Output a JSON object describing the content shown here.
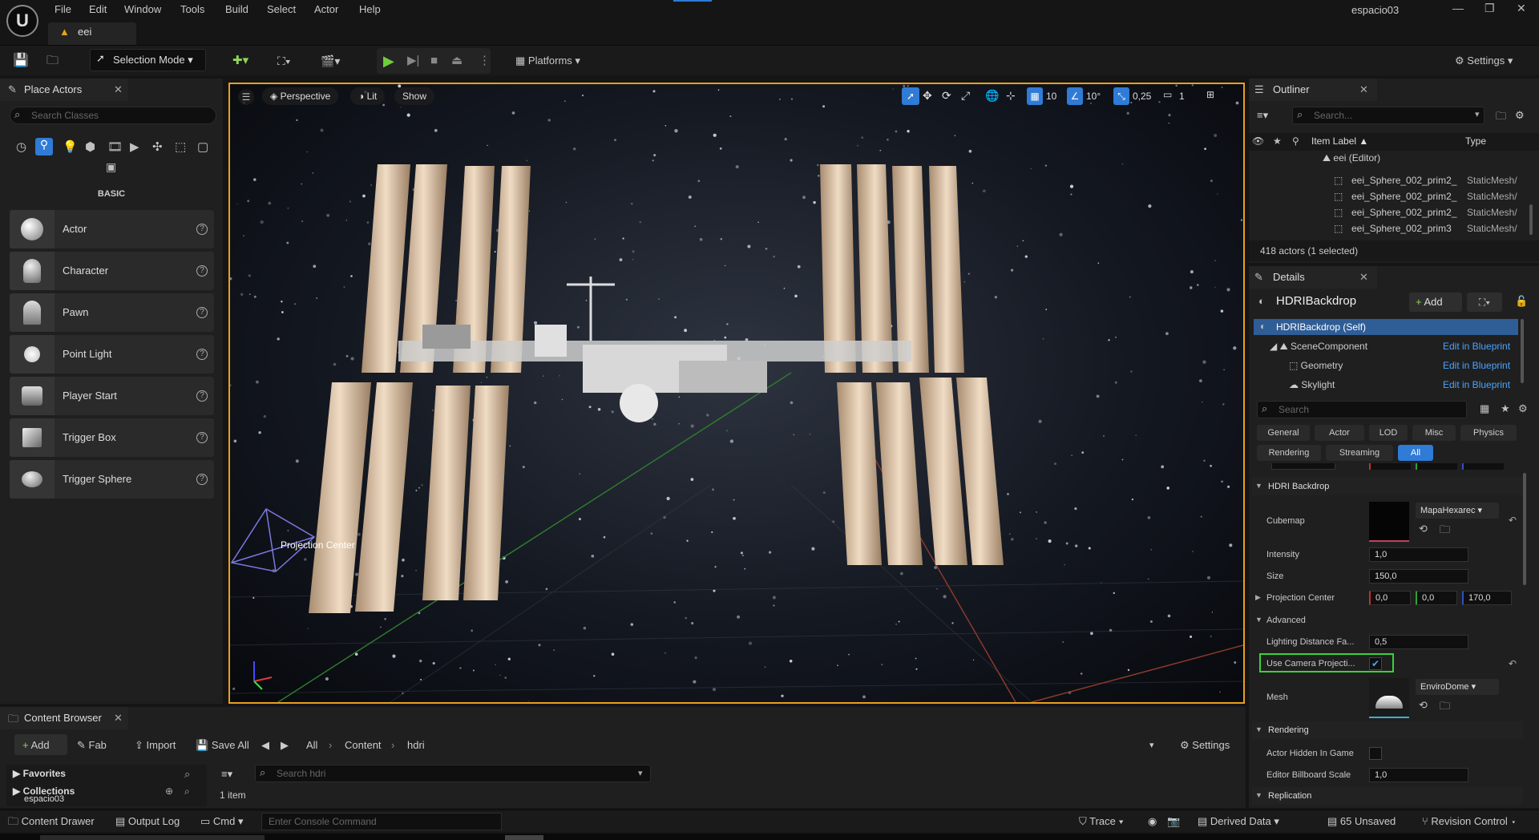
{
  "app": {
    "project_tab": "eei",
    "window_title": "espacio03"
  },
  "menu": [
    "File",
    "Edit",
    "Window",
    "Tools",
    "Build",
    "Select",
    "Actor",
    "Help"
  ],
  "toolbar": {
    "selection_mode": "Selection Mode",
    "platforms": "Platforms",
    "settings": "Settings"
  },
  "place_actors": {
    "title": "Place Actors",
    "search_placeholder": "Search Classes",
    "category": "BASIC",
    "items": [
      "Actor",
      "Character",
      "Pawn",
      "Point Light",
      "Player Start",
      "Trigger Box",
      "Trigger Sphere"
    ]
  },
  "viewport": {
    "perspective": "Perspective",
    "lit": "Lit",
    "show": "Show",
    "grid_size": "10",
    "rotation_snap": "10°",
    "scale_snap": "0,25",
    "camera_speed": "1",
    "overlay_label": "Projection Center"
  },
  "outliner": {
    "title": "Outliner",
    "search_placeholder": "Search...",
    "col_label": "Item Label ▲",
    "col_type": "Type",
    "root": "eei (Editor)",
    "rows": [
      {
        "label": "eei_Sphere_002_prim2_",
        "type": "StaticMesh/"
      },
      {
        "label": "eei_Sphere_002_prim2_",
        "type": "StaticMesh/"
      },
      {
        "label": "eei_Sphere_002_prim2_",
        "type": "StaticMesh/"
      },
      {
        "label": "eei_Sphere_002_prim3",
        "type": "StaticMesh/"
      }
    ],
    "count": "418 actors (1 selected)"
  },
  "details": {
    "title": "Details",
    "object": "HDRIBackdrop",
    "add": "Add",
    "components": [
      {
        "label": "HDRIBackdrop (Self)",
        "link": ""
      },
      {
        "label": "SceneComponent",
        "link": "Edit in Blueprint"
      },
      {
        "label": "Geometry",
        "link": "Edit in Blueprint"
      },
      {
        "label": "Skylight",
        "link": "Edit in Blueprint"
      }
    ],
    "search_placeholder": "Search",
    "tabs_row1": [
      "General",
      "Actor",
      "LOD",
      "Misc",
      "Physics"
    ],
    "tabs_row2": [
      "Rendering",
      "Streaming",
      "All"
    ],
    "section_hdri": "HDRI Backdrop",
    "cubemap_label": "Cubemap",
    "cubemap_value": "MapaHexarec",
    "intensity_label": "Intensity",
    "intensity_value": "1,0",
    "size_label": "Size",
    "size_value": "150,0",
    "proj_label": "Projection Center",
    "proj_x": "0,0",
    "proj_y": "0,0",
    "proj_z": "170,0",
    "section_advanced": "Advanced",
    "lighting_label": "Lighting Distance Fa...",
    "lighting_value": "0,5",
    "camera_proj_label": "Use Camera Projecti...",
    "mesh_label": "Mesh",
    "mesh_value": "EnviroDome",
    "section_rendering": "Rendering",
    "hidden_label": "Actor Hidden In Game",
    "billboard_label": "Editor Billboard Scale",
    "billboard_value": "1,0",
    "section_replication": "Replication"
  },
  "content_browser": {
    "title": "Content Browser",
    "add": "Add",
    "fab": "Fab",
    "import": "Import",
    "save_all": "Save All",
    "path": [
      "All",
      "Content",
      "hdri"
    ],
    "settings": "Settings",
    "favorites": "Favorites",
    "collections": "Collections",
    "project": "espacio03",
    "search_placeholder": "Search hdri",
    "count": "1 item"
  },
  "status": {
    "drawer": "Content Drawer",
    "output": "Output Log",
    "cmd": "Cmd",
    "console_placeholder": "Enter Console Command",
    "trace": "Trace",
    "derived": "Derived Data",
    "unsaved": "65 Unsaved",
    "revision": "Revision Control"
  }
}
